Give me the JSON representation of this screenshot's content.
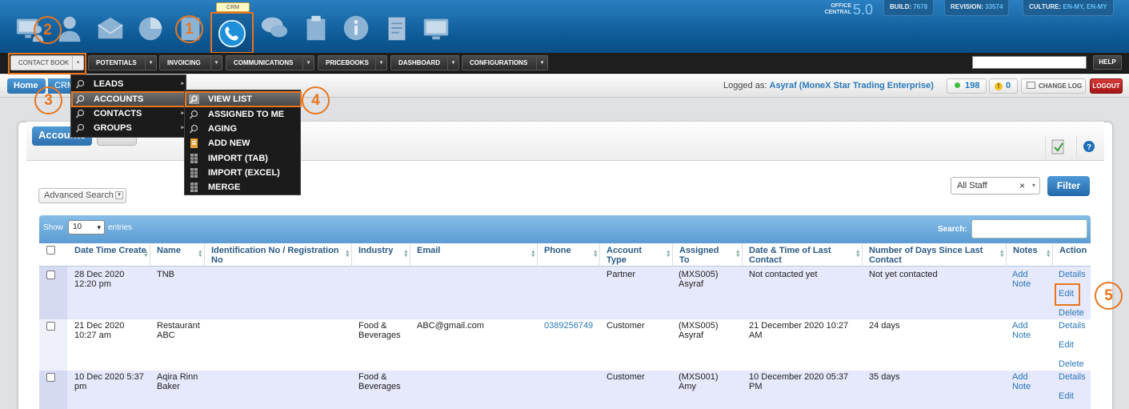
{
  "header": {
    "crm_tooltip": "CRM",
    "brand_small": "OFFICE CENTRAL",
    "brand_version": "5.0",
    "build_label": "BUILD:",
    "build_value": "7678",
    "revision_label": "REVISION:",
    "revision_value": "33574",
    "culture_label": "CULTURE:",
    "culture_value": "EN-MY, EN-MY",
    "app_icons": [
      "monitor-person-icon",
      "user-icon",
      "mail-icon",
      "pie-chart-icon",
      "phone-icon",
      "chat-icon",
      "clipboard-icon",
      "info-icon",
      "notepad-icon",
      "monitor-icon"
    ]
  },
  "nav": {
    "items": [
      "CONTACT BOOK",
      "POTENTIALS",
      "INVOICING",
      "COMMUNICATIONS",
      "PRICEBOOKS",
      "DASHBOARD",
      "CONFIGURATIONS"
    ],
    "help": "HELP",
    "search_value": ""
  },
  "subbar": {
    "home": "Home",
    "crm": "CRM",
    "logged_prefix": "Logged as:",
    "logged_user": "Asyraf (MoneX Star Trading Enterprise)",
    "count_green": "198",
    "count_warn": "0",
    "changelog": "CHANGE LOG",
    "logout": "LOGOUT"
  },
  "menu_level1": {
    "items": [
      "LEADS",
      "ACCOUNTS",
      "CONTACTS",
      "GROUPS"
    ],
    "highlighted": "ACCOUNTS"
  },
  "menu_level2": {
    "items": [
      "VIEW LIST",
      "ASSIGNED TO ME",
      "AGING",
      "ADD NEW",
      "IMPORT (TAB)",
      "IMPORT (EXCEL)",
      "MERGE"
    ],
    "highlighted": "VIEW LIST"
  },
  "panel": {
    "tab_title": "Accounts",
    "advanced_search": "Advanced Search",
    "staff_filter": "All Staff",
    "staff_clear": "×",
    "filter_button": "Filter",
    "show_label": "Show",
    "show_value": "10",
    "entries_label": "entries",
    "search_label": "Search:"
  },
  "table": {
    "columns": [
      "Date Time Create",
      "Name",
      "Identification No / Registration No",
      "Industry",
      "Email",
      "Phone",
      "Account Type",
      "Assigned To",
      "Date & Time of Last Contact",
      "Number of Days Since Last Contact",
      "Notes",
      "Action"
    ],
    "rows": [
      {
        "date": "28 Dec 2020 12:20 pm",
        "name": "TNB",
        "idno": "",
        "industry": "",
        "email": "",
        "phone": "",
        "type": "Partner",
        "assigned": "(MXS005) Asyraf",
        "last_contact": "Not contacted yet",
        "days": "Not yet contacted",
        "notes": [
          "Add",
          "Note"
        ],
        "actions": [
          "Details",
          "Edit",
          "Delete"
        ]
      },
      {
        "date": "21 Dec 2020 10:27 am",
        "name": "Restaurant ABC",
        "idno": "",
        "industry": "Food & Beverages",
        "email": "ABC@gmail.com",
        "phone": "0389256749",
        "type": "Customer",
        "assigned": "(MXS005) Asyraf",
        "last_contact": "21 December 2020 10:27 AM",
        "days": "24 days",
        "notes": [
          "Add",
          "Note"
        ],
        "actions": [
          "Details",
          "Edit",
          "Delete"
        ]
      },
      {
        "date": "10 Dec 2020 5:37 pm",
        "name": "Aqira Rinn Baker",
        "idno": "",
        "industry": "Food & Beverages",
        "email": "",
        "phone": "",
        "type": "Customer",
        "assigned": "(MXS001) Amy",
        "last_contact": "10 December 2020 05:37 PM",
        "days": "35 days",
        "notes": [
          "Add",
          "Note"
        ],
        "actions": [
          "Details",
          "Edit"
        ]
      }
    ]
  },
  "annotations": {
    "step1": "1",
    "step2": "2",
    "step3": "3",
    "step4": "4",
    "step5": "5"
  },
  "colors": {
    "accent": "#e8761e",
    "link": "#2a79b8",
    "header_blue": "#0d5a96"
  }
}
